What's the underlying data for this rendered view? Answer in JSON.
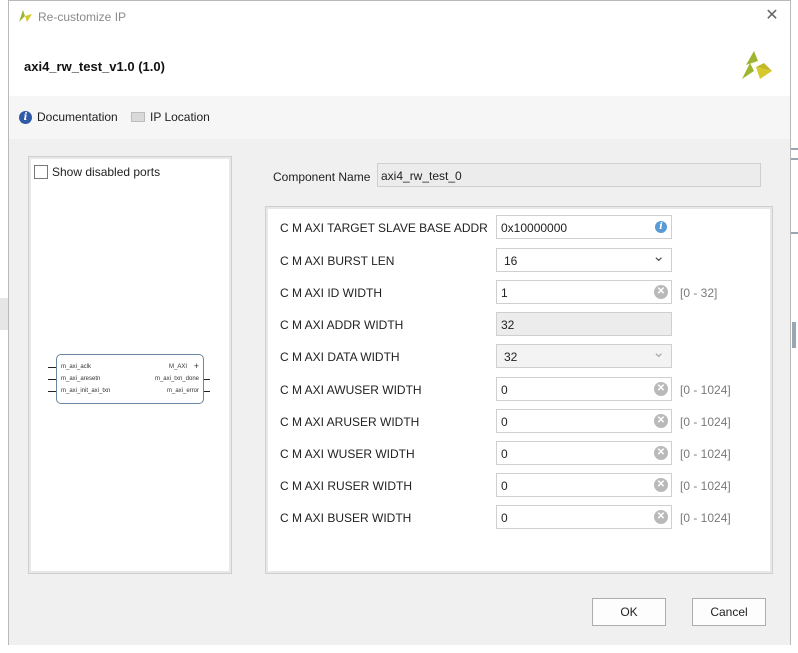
{
  "window": {
    "title": "Re-customize IP"
  },
  "header": {
    "ip_title": "axi4_rw_test_v1.0 (1.0)"
  },
  "toolbar": {
    "documentation": "Documentation",
    "ip_location": "IP Location"
  },
  "left_panel": {
    "show_disabled_ports": "Show disabled ports",
    "block": {
      "left_ports": [
        "m_axi_aclk",
        "m_axi_aresetn",
        "m_axi_init_axi_txn"
      ],
      "right_ports": [
        "M_AXI",
        "m_axi_txn_done",
        "m_axi_error"
      ]
    }
  },
  "component": {
    "label": "Component Name",
    "value": "axi4_rw_test_0"
  },
  "params": [
    {
      "label": "C M AXI TARGET SLAVE BASE ADDR",
      "value": "0x10000000",
      "kind": "info",
      "range": ""
    },
    {
      "label": "C M AXI BURST LEN",
      "value": "16",
      "kind": "dropdown",
      "range": ""
    },
    {
      "label": "C M AXI ID WIDTH",
      "value": "1",
      "kind": "clear",
      "range": "[0 - 32]"
    },
    {
      "label": "C M AXI ADDR WIDTH",
      "value": "32",
      "kind": "readonly",
      "range": ""
    },
    {
      "label": "C M AXI DATA WIDTH",
      "value": "32",
      "kind": "dropdown-disabled",
      "range": ""
    },
    {
      "label": "C M AXI AWUSER WIDTH",
      "value": "0",
      "kind": "clear",
      "range": "[0 - 1024]"
    },
    {
      "label": "C M AXI ARUSER WIDTH",
      "value": "0",
      "kind": "clear",
      "range": "[0 - 1024]"
    },
    {
      "label": "C M AXI WUSER WIDTH",
      "value": "0",
      "kind": "clear",
      "range": "[0 - 1024]"
    },
    {
      "label": "C M AXI RUSER WIDTH",
      "value": "0",
      "kind": "clear",
      "range": "[0 - 1024]"
    },
    {
      "label": "C M AXI BUSER WIDTH",
      "value": "0",
      "kind": "clear",
      "range": "[0 - 1024]"
    }
  ],
  "footer": {
    "ok": "OK",
    "cancel": "Cancel"
  },
  "colors": {
    "accent": "#2e5aa8",
    "logo_green": "#9fb530",
    "logo_yellow": "#d8c92a"
  }
}
